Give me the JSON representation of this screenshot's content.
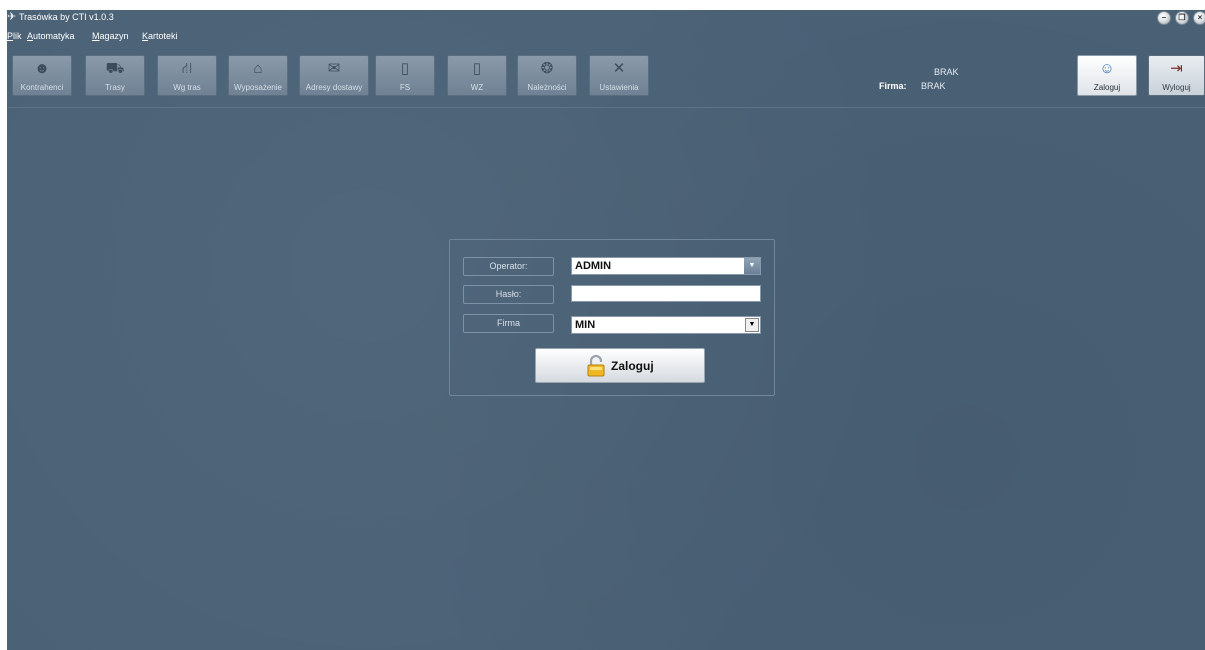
{
  "window": {
    "title": "Trasówka by CTI v1.0.3",
    "app_icon": "arrows-icon",
    "controls": [
      "minimize",
      "restore",
      "close"
    ]
  },
  "menu": [
    {
      "label": "Plik",
      "underline": "P"
    },
    {
      "label": "Automatyka",
      "underline": "A"
    },
    {
      "label": "Magazyn",
      "underline": "M"
    },
    {
      "label": "Kartoteki",
      "underline": "K"
    }
  ],
  "toolbar": {
    "buttons": [
      {
        "label": "Kontrahenci",
        "icon": "contacts-icon"
      },
      {
        "label": "Trasy",
        "icon": "truck-icon"
      },
      {
        "label": "Wg tras",
        "icon": "road-icon"
      },
      {
        "label": "Wyposażenie",
        "icon": "home-icon"
      },
      {
        "label": "Adresy dostawy",
        "icon": "mailbox-icon"
      },
      {
        "label": "FS",
        "icon": "document-icon"
      },
      {
        "label": "WZ",
        "icon": "document-icon"
      },
      {
        "label": "Należności",
        "icon": "money-icon"
      },
      {
        "label": "Ustawienia",
        "icon": "tools-icon"
      }
    ],
    "firma_label": "Firma:",
    "status_top": "BRAK",
    "status_firma": "BRAK",
    "login_label": "Zaloguj",
    "logout_label": "Wyloguj"
  },
  "login": {
    "operator_label": "Operator:",
    "operator_value": "ADMIN",
    "password_label": "Hasło:",
    "password_value": "",
    "company_label": "Firma",
    "company_value": "MIN",
    "submit_label": "Zaloguj"
  },
  "colors": {
    "background": "#4a6176",
    "toolbar_button": "#7d8e9f",
    "accent_lock": "#f2b824"
  }
}
